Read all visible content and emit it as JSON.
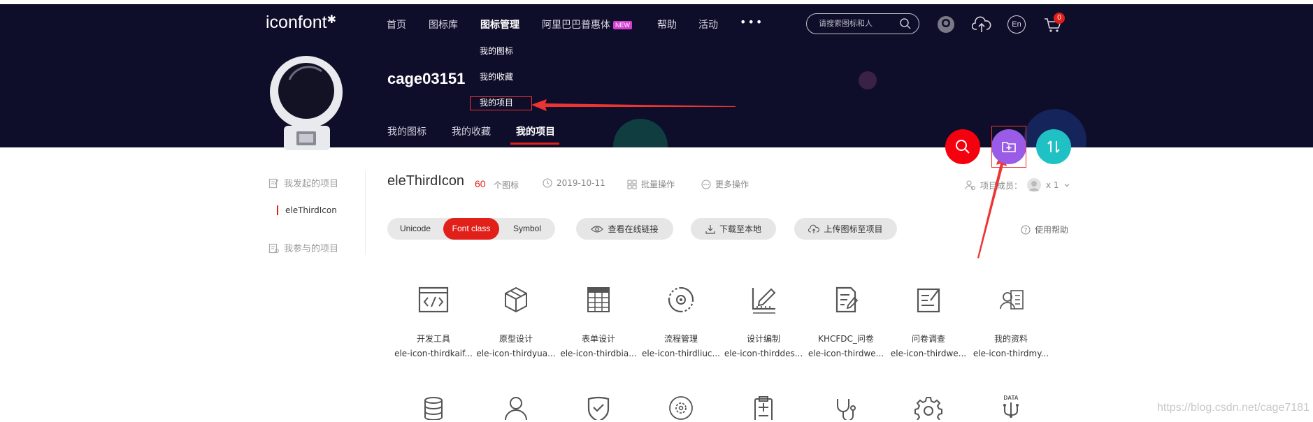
{
  "header": {
    "logo": "iconfont",
    "nav": [
      {
        "label": "首页"
      },
      {
        "label": "图标库"
      },
      {
        "label": "图标管理",
        "active": true
      },
      {
        "label": "阿里巴巴普惠体",
        "badge": "NEW"
      },
      {
        "label": "帮助"
      },
      {
        "label": "活动"
      }
    ],
    "more": "•••",
    "search_placeholder": "请搜索图标和人",
    "cart_count": "0",
    "lang_icon_text": "En",
    "dropdown": [
      "我的图标",
      "我的收藏",
      "我的项目"
    ]
  },
  "profile": {
    "username": "cage03151",
    "tabs": [
      "我的图标",
      "我的收藏",
      "我的项目"
    ],
    "active_tab": "我的项目"
  },
  "sidebar": {
    "started_projects": "我发起的项目",
    "current_project": "eleThirdIcon",
    "joined_projects": "我参与的项目"
  },
  "project": {
    "name": "eleThirdIcon",
    "count": "60",
    "count_label": "个图标",
    "date": "2019-10-11",
    "batch_label": "批量操作",
    "more_label": "更多操作",
    "members_label": "项目成员：",
    "members_count": "x 1"
  },
  "toolbar": {
    "modes": [
      "Unicode",
      "Font class",
      "Symbol"
    ],
    "active_mode": "Font class",
    "view_link": "查看在线链接",
    "download": "下载至本地",
    "upload": "上传图标至项目",
    "help": "使用帮助"
  },
  "icons": [
    {
      "name": "开发工具",
      "code": "ele-icon-thirdkaif...",
      "icon": "code-window-icon"
    },
    {
      "name": "原型设计",
      "code": "ele-icon-thirdyua...",
      "icon": "cube-icon"
    },
    {
      "name": "表单设计",
      "code": "ele-icon-thirdbia...",
      "icon": "table-form-icon"
    },
    {
      "name": "流程管理",
      "code": "ele-icon-thirdliuc...",
      "icon": "process-cycle-icon"
    },
    {
      "name": "设计编制",
      "code": "ele-icon-thirddes...",
      "icon": "ruler-pen-icon"
    },
    {
      "name": "KHCFDC_问卷",
      "code": "ele-icon-thirdwe...",
      "icon": "questionnaire-doc-icon"
    },
    {
      "name": "问卷调查",
      "code": "ele-icon-thirdwe...",
      "icon": "survey-edit-icon"
    },
    {
      "name": "我的资料",
      "code": "ele-icon-thirdmy...",
      "icon": "profile-card-icon"
    }
  ],
  "icons_row2": [
    "database-icon",
    "user-icon",
    "shield-check-icon",
    "gear-circle-icon",
    "clipboard-icon",
    "stethoscope-icon",
    "settings-gear-icon",
    "data-tree-icon"
  ],
  "row2_label": "DATA",
  "watermark": "https://blog.csdn.net/cage7181",
  "colors": {
    "header_bg": "#0f0e2a",
    "accent": "#e1201a",
    "fab_search": "#f5000f",
    "fab_folder": "#9a5ce6",
    "fab_sort": "#1fc1c4"
  }
}
